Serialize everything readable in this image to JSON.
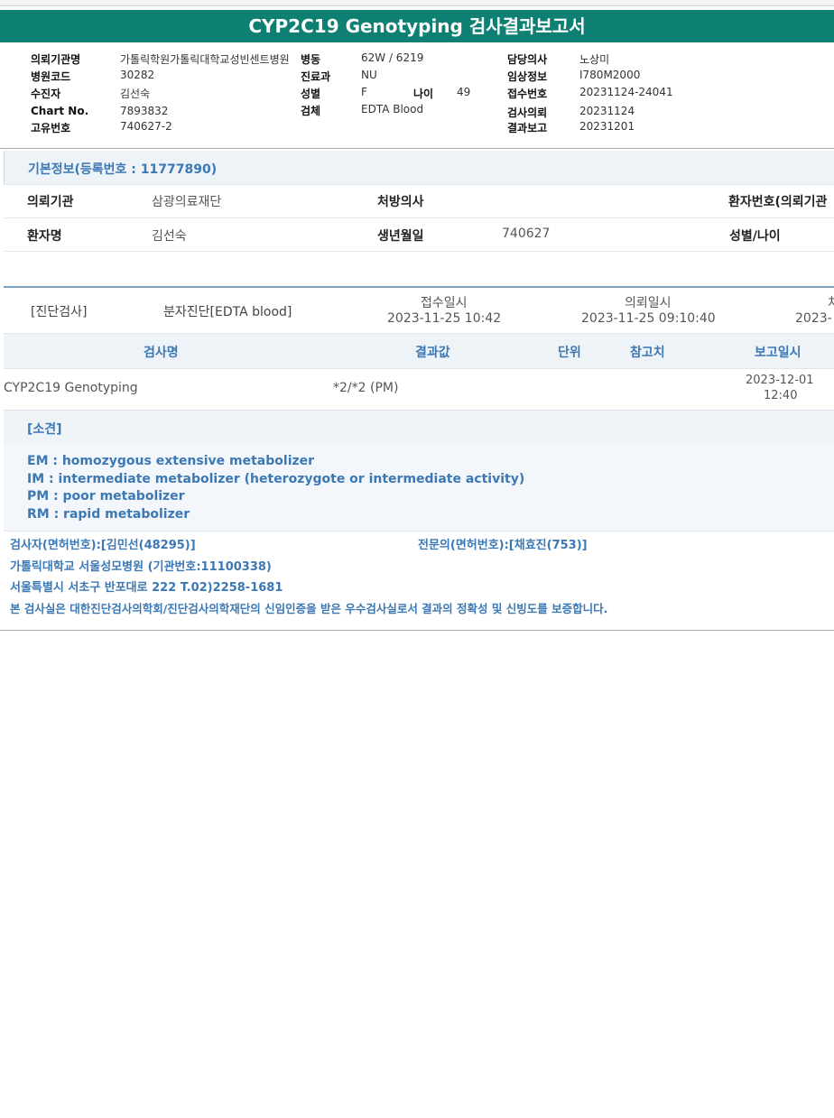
{
  "title": "CYP2C19 Genotyping 검사결과보고서",
  "header": {
    "col1": [
      {
        "k": "의뢰기관명",
        "v": "가톨릭학원가톨릭대학교성빈센트병원"
      },
      {
        "k": "병원코드",
        "v": "30282"
      },
      {
        "k": "수진자",
        "v": "김선숙"
      },
      {
        "k": "Chart No.",
        "v": "7893832"
      },
      {
        "k": "고유번호",
        "v": "740627-2"
      }
    ],
    "col2": [
      {
        "k": "병동",
        "v": "62W / 6219"
      },
      {
        "k": "진료과",
        "v": "NU"
      },
      {
        "k": "성별",
        "v": "F"
      },
      {
        "k": "검체",
        "v": "EDTA Blood"
      }
    ],
    "age": {
      "k": "나이",
      "v": "49"
    },
    "col3": [
      {
        "k": "담당의사",
        "v": "노상미"
      },
      {
        "k": "임상정보",
        "v": "I780M2000"
      },
      {
        "k": "접수번호",
        "v": "20231124-24041"
      },
      {
        "k": "검사의뢰",
        "v": "20231124"
      },
      {
        "k": "결과보고",
        "v": "20231201"
      }
    ]
  },
  "basic": {
    "title": "기본정보(등록번호 : 11777890)",
    "row1": {
      "l1": "의뢰기관",
      "v1": "삼광의료재단",
      "l2": "처방의사",
      "v2": "",
      "l3": "환자번호(의뢰기관"
    },
    "row2": {
      "l1": "환자명",
      "v1": "김선숙",
      "l2": "생년월일",
      "v2": "740627",
      "l3": "성별/나이"
    }
  },
  "test": {
    "category": "[진단검사]",
    "specimen": "분자진단[EDTA blood]",
    "received_label": "접수일시",
    "received_value": "2023-11-25 10:42",
    "requested_label": "의뢰일시",
    "requested_value": "2023-11-25 09:10:40",
    "extra_label": "처",
    "extra_value": "2023-"
  },
  "table": {
    "headers": [
      "검사명",
      "결과값",
      "단위",
      "참고치",
      "보고일시"
    ],
    "rows": [
      {
        "name": "CYP2C19 Genotyping",
        "result": "*2/*2 (PM)",
        "unit": "",
        "ref": "",
        "date": "2023-12-01",
        "time": "12:40"
      }
    ]
  },
  "comment": {
    "title": "[소견]",
    "lines": [
      "EM : homozygous extensive metabolizer",
      "IM  : intermediate metabolizer (heterozygote or intermediate activity)",
      "PM : poor metabolizer",
      "RM : rapid metabolizer"
    ]
  },
  "footer": {
    "examiner": "검사자(면허번호):[김민선(48295)]",
    "specialist": "전문의(면허번호):[채효진(753)]",
    "institution": "가톨릭대학교 서울성모병원 (기관번호:11100338)",
    "address": "서울특별시 서초구 반포대로 222 T.02)2258-1681",
    "certification": "본 검사실은 대한진단검사의학회/진단검사의학재단의 신임인증을 받은 우수검사실로서 결과의 정확성 및 신빙도를 보증합니다."
  }
}
